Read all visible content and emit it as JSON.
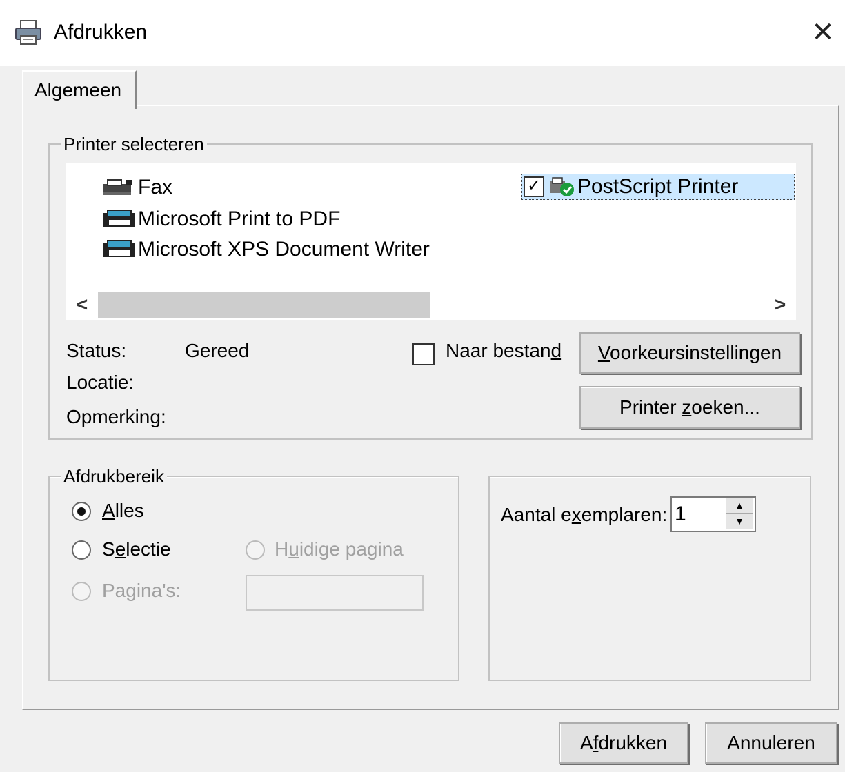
{
  "window": {
    "title": "Afdrukken",
    "close_icon": "close-icon",
    "title_icon": "printer-icon"
  },
  "tabs": [
    {
      "label": "Algemeen",
      "selected": true
    }
  ],
  "printer_group": {
    "legend": "Printer selecteren",
    "printers": [
      {
        "label": "Fax",
        "icon": "fax-printer-icon"
      },
      {
        "label": "Microsoft Print to PDF",
        "icon": "printer-icon"
      },
      {
        "label": "Microsoft XPS Document Writer",
        "icon": "printer-icon"
      },
      {
        "label": "PostScript Printer",
        "icon": "default-printer-icon",
        "selected": true,
        "checked": true
      }
    ],
    "scroll_left": "<",
    "scroll_right": ">",
    "status_label": "Status:",
    "status_value": "Gereed",
    "location_label": "Locatie:",
    "comment_label": "Opmerking:",
    "to_file_label_pre": "Naar bestan",
    "to_file_label_ul": "d",
    "to_file_checked": false,
    "preferences_ul": "V",
    "preferences_rest": "oorkeursinstellingen",
    "find_pre": "Printer ",
    "find_ul": "z",
    "find_rest": "oeken..."
  },
  "range_group": {
    "legend": "Afdrukbereik",
    "all_ul": "A",
    "all_rest": "lles",
    "selection_pre": "S",
    "selection_ul": "e",
    "selection_rest": "lectie",
    "current_pre": "H",
    "current_ul": "u",
    "current_rest": "idige pagina",
    "pages_pre": "Pa",
    "pages_ul": "g",
    "pages_rest": "ina's:",
    "pages_value": "",
    "selected": "all"
  },
  "copies_group": {
    "label_pre": "Aantal e",
    "label_ul": "x",
    "label_rest": "emplaren:",
    "value": "1"
  },
  "footer": {
    "print_pre": "A",
    "print_ul": "f",
    "print_rest": "drukken",
    "cancel_label": "Annuleren"
  }
}
